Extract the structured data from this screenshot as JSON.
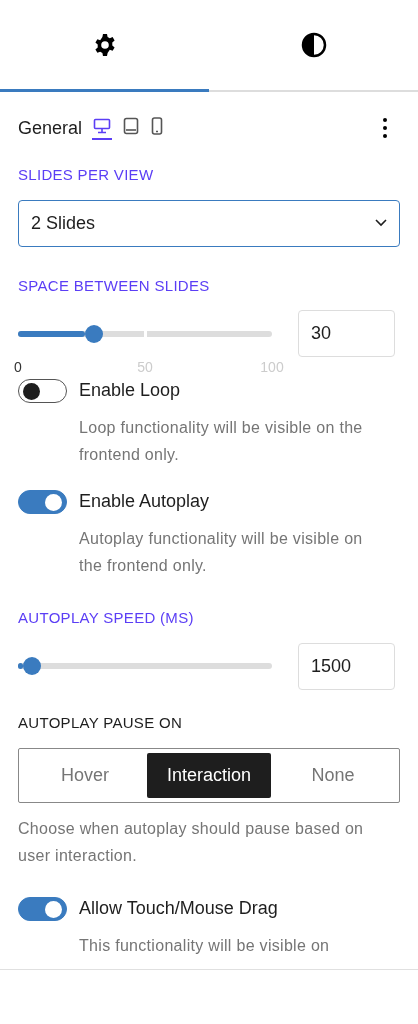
{
  "tabs": [
    {
      "kind": "settings",
      "selected": true
    },
    {
      "kind": "style",
      "selected": false
    }
  ],
  "header": {
    "title": "General",
    "devices": [
      {
        "kind": "desktop",
        "selected": true
      },
      {
        "kind": "tablet",
        "selected": false
      },
      {
        "kind": "mobile",
        "selected": false
      }
    ]
  },
  "controls": [
    {
      "kind": "select",
      "label": "SLIDES PER VIEW",
      "value": "2 Slides"
    },
    {
      "kind": "slider",
      "label": "SPACE BETWEEN SLIDES",
      "level": 0.3,
      "value": "30",
      "marks": [
        "0",
        "50",
        "100"
      ]
    },
    {
      "kind": "toggle",
      "label": "Enable Loop",
      "on": false,
      "help": "Loop functionality will be visible on the frontend only."
    },
    {
      "kind": "toggle",
      "label": "Enable Autoplay",
      "on": true,
      "help": "Autoplay functionality will be visible on the frontend only."
    },
    {
      "kind": "slider",
      "label": "AUTOPLAY SPEED (MS)",
      "level": 0.055,
      "value": "1500"
    },
    {
      "kind": "segmented",
      "label": "AUTOPLAY PAUSE ON",
      "options": [
        {
          "label": "Hover",
          "selected": false
        },
        {
          "label": "Interaction",
          "selected": true
        },
        {
          "label": "None",
          "selected": false
        }
      ],
      "help": "Choose when autoplay should pause based on user interaction."
    },
    {
      "kind": "toggle",
      "label": "Allow Touch/Mouse Drag",
      "on": true,
      "help": "This functionality will be visible on"
    }
  ]
}
